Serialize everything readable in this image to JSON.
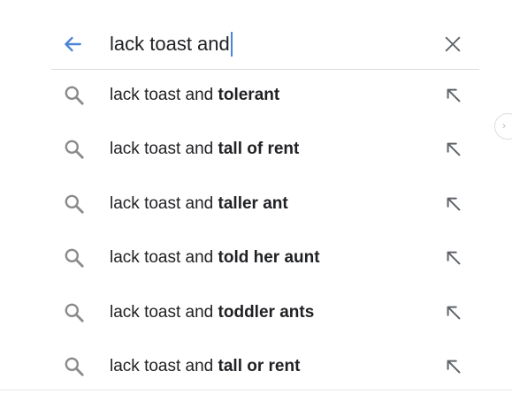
{
  "search": {
    "query": "lack toast and",
    "back_icon": "arrow-left-icon",
    "clear_icon": "close-icon",
    "accent_color": "#4a85d6"
  },
  "suggestions": [
    {
      "prefix": "lack toast and ",
      "completion": "tolerant"
    },
    {
      "prefix": "lack toast and ",
      "completion": "tall of rent"
    },
    {
      "prefix": "lack toast and ",
      "completion": "taller ant"
    },
    {
      "prefix": "lack toast and ",
      "completion": "told her aunt"
    },
    {
      "prefix": "lack toast and ",
      "completion": "toddler ants"
    },
    {
      "prefix": "lack toast and ",
      "completion": "tall or rent"
    }
  ],
  "icons": {
    "suggestion_icon": "search-icon",
    "fill_icon": "arrow-up-left-icon"
  },
  "side_control": {
    "glyph": "›"
  }
}
